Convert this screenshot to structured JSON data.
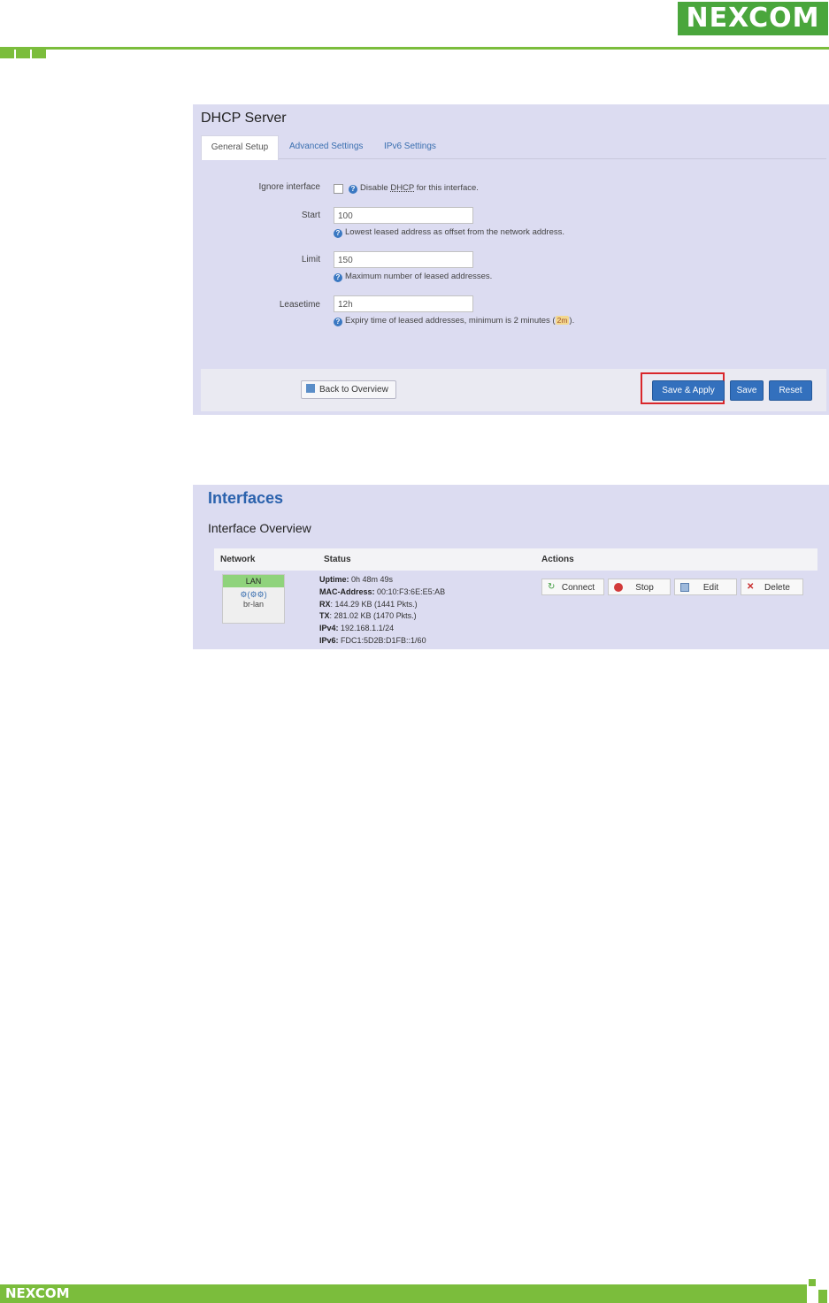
{
  "brand": {
    "logo_text": "NEXCOM",
    "accent": "#7bbd3c",
    "logo_bg": "#4aa63c"
  },
  "dhcp": {
    "title": "DHCP Server",
    "tabs": [
      "General Setup",
      "Advanced Settings",
      "IPv6 Settings"
    ],
    "ignore": {
      "label": "Ignore interface",
      "help_pre": "Disable ",
      "help_abbr": "DHCP",
      "help_post": " for this interface."
    },
    "start": {
      "label": "Start",
      "value": "100",
      "help": "Lowest leased address as offset from the network address."
    },
    "limit": {
      "label": "Limit",
      "value": "150",
      "help": "Maximum number of leased addresses."
    },
    "leasetime": {
      "label": "Leasetime",
      "value": "12h",
      "help_pre": "Expiry time of leased addresses, minimum is 2 minutes (",
      "help_code": "2m",
      "help_post": ")."
    },
    "buttons": {
      "back": "Back to Overview",
      "save_apply": "Save & Apply",
      "save": "Save",
      "reset": "Reset"
    }
  },
  "interfaces": {
    "title": "Interfaces",
    "subtitle": "Interface Overview",
    "columns": [
      "Network",
      "Status",
      "Actions"
    ],
    "lan": {
      "name": "LAN",
      "device": "br-lan"
    },
    "status": [
      {
        "k": "Uptime:",
        "v": "0h 48m 49s"
      },
      {
        "k": "MAC-Address:",
        "v": "00:10:F3:6E:E5:AB"
      },
      {
        "k": "RX",
        "v": ": 144.29 KB (1441 Pkts.)"
      },
      {
        "k": "TX",
        "v": ": 281.02 KB (1470 Pkts.)"
      },
      {
        "k": "IPv4:",
        "v": "192.168.1.1/24"
      },
      {
        "k": "IPv6:",
        "v": "FDC1:5D2B:D1FB::1/60"
      }
    ],
    "actions": [
      "Connect",
      "Stop",
      "Edit",
      "Delete"
    ]
  }
}
